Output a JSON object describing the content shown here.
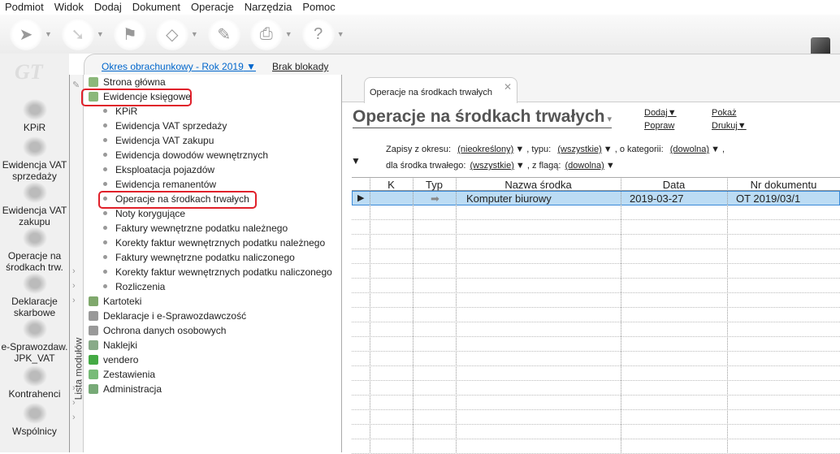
{
  "menu": [
    "Podmiot",
    "Widok",
    "Dodaj",
    "Dokument",
    "Operacje",
    "Narzędzia",
    "Pomoc"
  ],
  "toolbar": [
    {
      "icon": "back-arrow-icon",
      "dropdown": true
    },
    {
      "icon": "forward-arrow-icon",
      "dropdown": true
    },
    {
      "icon": "flag-icon",
      "dropdown": false
    },
    {
      "icon": "document-icon",
      "dropdown": true
    },
    {
      "icon": "broom-icon",
      "dropdown": false
    },
    {
      "icon": "printer-icon",
      "dropdown": true
    },
    {
      "icon": "help-icon",
      "dropdown": true
    }
  ],
  "logo": "GT",
  "left_nav": [
    "KPiR",
    "Ewidencja VAT sprzedaży",
    "Ewidencja VAT zakupu",
    "Operacje na środkach trw.",
    "Deklaracje skarbowe",
    "e-Sprawozdaw. JPK_VAT",
    "Kontrahenci",
    "Wspólnicy"
  ],
  "header": {
    "period": "Okres obrachunkowy - Rok 2019",
    "lock": "Brak blokady"
  },
  "module_strip": "Lista modułów",
  "tree": {
    "top1": [
      "Strona główna",
      "Ewidencje księgowe"
    ],
    "sub": [
      "KPiR",
      "Ewidencja VAT sprzedaży",
      "Ewidencja VAT zakupu",
      "Ewidencja dowodów wewnętrznych",
      "Eksploatacja pojazdów",
      "Ewidencja remanentów",
      "Operacje na środkach trwałych",
      "Noty korygujące",
      "Faktury wewnętrzne podatku należnego",
      "Korekty faktur wewnętrznych podatku należnego",
      "Faktury wewnętrzne podatku naliczonego",
      "Korekty faktur wewnętrznych podatku naliczonego",
      "Rozliczenia"
    ],
    "top2": [
      "Kartoteki",
      "Deklaracje i e-Sprawozdawczość",
      "Ochrona danych osobowych",
      "Naklejki",
      "vendero",
      "Zestawienia",
      "Administracja"
    ]
  },
  "tab": "Operacje na środkach trwałych",
  "page_title": "Operacje na środkach trwałych",
  "actions": {
    "add": "Dodaj",
    "edit": "Popraw",
    "show": "Pokaż",
    "print": "Drukuj"
  },
  "filters": {
    "l1": "Zapisy z okresu:",
    "v1": "(nieokreślony)",
    "l2": ", typu:",
    "v2": "(wszystkie)",
    "l3": ", o kategorii:",
    "v3": "(dowolna)",
    "l3b": ",",
    "l4": "dla środka trwałego:",
    "v4": "(wszystkie)",
    "l5": ", z flagą:",
    "v5": "(dowolna)"
  },
  "table": {
    "columns": [
      "K",
      "Typ",
      "Nazwa środka",
      "Data",
      "Nr dokumentu"
    ],
    "rows": [
      {
        "k": "",
        "typ": "arrow",
        "name": "Komputer biurowy",
        "date": "2019-03-27",
        "doc": "OT 2019/03/1"
      }
    ]
  }
}
